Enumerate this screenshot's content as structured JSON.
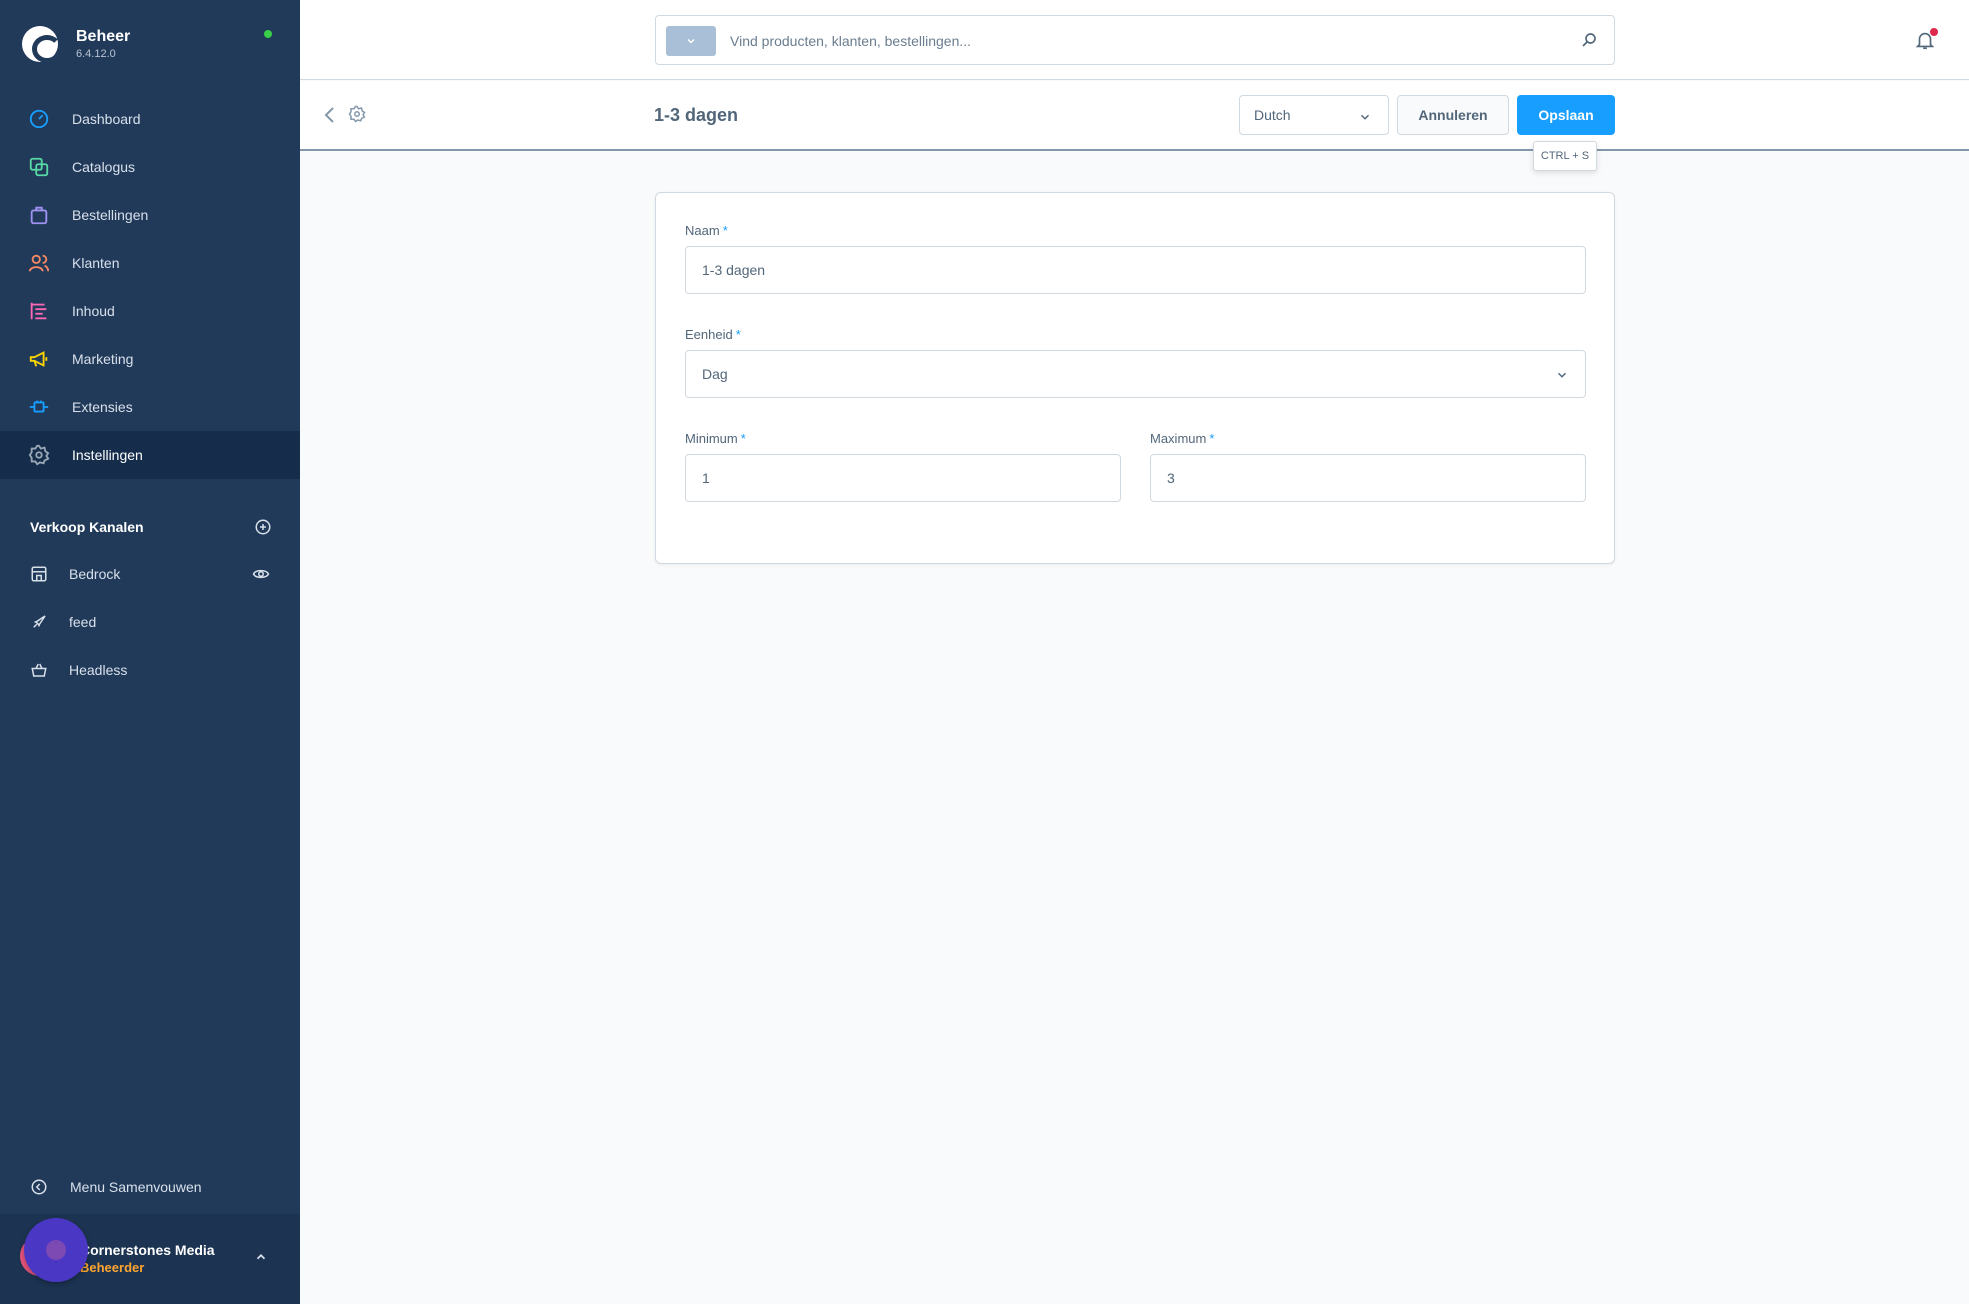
{
  "app": {
    "name": "Beheer",
    "version": "6.4.12.0",
    "status_color": "#37d046"
  },
  "sidebar": {
    "items": [
      {
        "label": "Dashboard",
        "icon": "dashboard-icon",
        "color": "#189eff"
      },
      {
        "label": "Catalogus",
        "icon": "catalog-icon",
        "color": "#57d9a3"
      },
      {
        "label": "Bestellingen",
        "icon": "orders-icon",
        "color": "#a092f0"
      },
      {
        "label": "Klanten",
        "icon": "customers-icon",
        "color": "#f88962"
      },
      {
        "label": "Inhoud",
        "icon": "content-icon",
        "color": "#ff68b4"
      },
      {
        "label": "Marketing",
        "icon": "marketing-icon",
        "color": "#ffd700"
      },
      {
        "label": "Extensies",
        "icon": "extensions-icon",
        "color": "#189eff"
      },
      {
        "label": "Instellingen",
        "icon": "settings-icon",
        "color": "#9aa8b5"
      }
    ],
    "active": "Instellingen",
    "channels_title": "Verkoop Kanalen",
    "channels": [
      {
        "label": "Bedrock",
        "icon": "storefront-icon"
      },
      {
        "label": "feed",
        "icon": "rocket-icon"
      },
      {
        "label": "Headless",
        "icon": "basket-icon"
      }
    ],
    "collapse_label": "Menu Samenvouwen",
    "user": {
      "name": "Cornerstones Media",
      "role": "Beheerder",
      "role_color": "#ffa52f"
    }
  },
  "search": {
    "placeholder": "Vind producten, klanten, bestellingen..."
  },
  "smartbar": {
    "title": "1-3 dagen",
    "language": "Dutch",
    "cancel_label": "Annuleren",
    "save_label": "Opslaan",
    "save_shortcut": "CTRL + S",
    "save_color": "#189eff"
  },
  "form": {
    "name_label": "Naam",
    "name_value": "1-3 dagen",
    "unit_label": "Eenheid",
    "unit_value": "Dag",
    "min_label": "Minimum",
    "min_value": "1",
    "max_label": "Maximum",
    "max_value": "3",
    "required_mark": "*"
  }
}
